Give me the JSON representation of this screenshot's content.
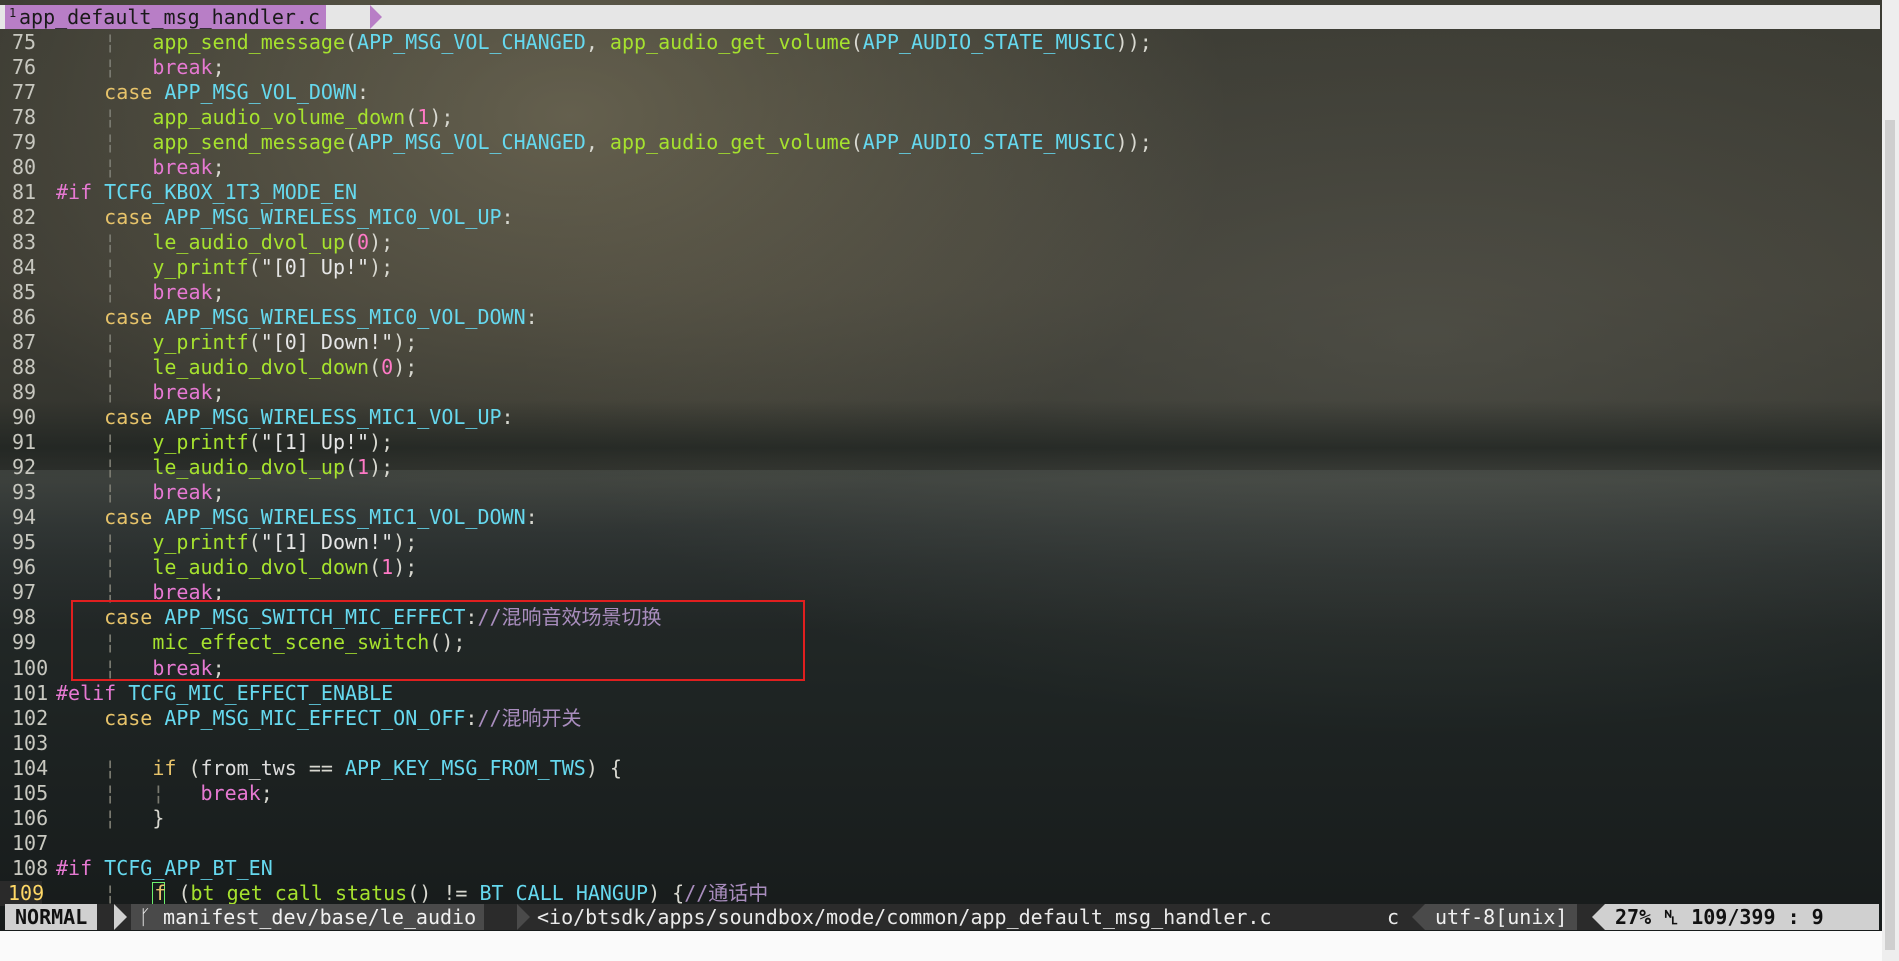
{
  "tab": {
    "number": "1",
    "filename": "app_default_msg_handler.c"
  },
  "lines": [
    {
      "n": "75",
      "guides": 1,
      "t": [
        [
          "fn",
          "app_send_message"
        ],
        [
          "punc",
          "("
        ],
        [
          "const",
          "APP_MSG_VOL_CHANGED"
        ],
        [
          "punc",
          ", "
        ],
        [
          "fn",
          "app_audio_get_volume"
        ],
        [
          "punc",
          "("
        ],
        [
          "const",
          "APP_AUDIO_STATE_MUSIC"
        ],
        [
          "punc",
          "));"
        ]
      ]
    },
    {
      "n": "76",
      "guides": 1,
      "t": [
        [
          "kw-break",
          "break"
        ],
        [
          "punc",
          ";"
        ]
      ]
    },
    {
      "n": "77",
      "guides": 0,
      "indent": 4,
      "t": [
        [
          "kw",
          "case "
        ],
        [
          "const",
          "APP_MSG_VOL_DOWN"
        ],
        [
          "punc",
          ":"
        ]
      ]
    },
    {
      "n": "78",
      "guides": 1,
      "t": [
        [
          "fn",
          "app_audio_volume_down"
        ],
        [
          "punc",
          "("
        ],
        [
          "num",
          "1"
        ],
        [
          "punc",
          ");"
        ]
      ]
    },
    {
      "n": "79",
      "guides": 1,
      "t": [
        [
          "fn",
          "app_send_message"
        ],
        [
          "punc",
          "("
        ],
        [
          "const",
          "APP_MSG_VOL_CHANGED"
        ],
        [
          "punc",
          ", "
        ],
        [
          "fn",
          "app_audio_get_volume"
        ],
        [
          "punc",
          "("
        ],
        [
          "const",
          "APP_AUDIO_STATE_MUSIC"
        ],
        [
          "punc",
          "));"
        ]
      ]
    },
    {
      "n": "80",
      "guides": 1,
      "t": [
        [
          "kw-break",
          "break"
        ],
        [
          "punc",
          ";"
        ]
      ]
    },
    {
      "n": "81",
      "guides": 0,
      "indent": 0,
      "t": [
        [
          "pp",
          "#if "
        ],
        [
          "const",
          "TCFG_KBOX_1T3_MODE_EN"
        ]
      ]
    },
    {
      "n": "82",
      "guides": 0,
      "indent": 4,
      "t": [
        [
          "kw",
          "case "
        ],
        [
          "const",
          "APP_MSG_WIRELESS_MIC0_VOL_UP"
        ],
        [
          "punc",
          ":"
        ]
      ]
    },
    {
      "n": "83",
      "guides": 1,
      "t": [
        [
          "fn",
          "le_audio_dvol_up"
        ],
        [
          "punc",
          "("
        ],
        [
          "num",
          "0"
        ],
        [
          "punc",
          ");"
        ]
      ]
    },
    {
      "n": "84",
      "guides": 1,
      "t": [
        [
          "fn",
          "y_printf"
        ],
        [
          "punc",
          "("
        ],
        [
          "str",
          "\"[0] Up!\""
        ],
        [
          "punc",
          ");"
        ]
      ]
    },
    {
      "n": "85",
      "guides": 1,
      "t": [
        [
          "kw-break",
          "break"
        ],
        [
          "punc",
          ";"
        ]
      ]
    },
    {
      "n": "86",
      "guides": 0,
      "indent": 4,
      "t": [
        [
          "kw",
          "case "
        ],
        [
          "const",
          "APP_MSG_WIRELESS_MIC0_VOL_DOWN"
        ],
        [
          "punc",
          ":"
        ]
      ]
    },
    {
      "n": "87",
      "guides": 1,
      "t": [
        [
          "fn",
          "y_printf"
        ],
        [
          "punc",
          "("
        ],
        [
          "str",
          "\"[0] Down!\""
        ],
        [
          "punc",
          ");"
        ]
      ]
    },
    {
      "n": "88",
      "guides": 1,
      "t": [
        [
          "fn",
          "le_audio_dvol_down"
        ],
        [
          "punc",
          "("
        ],
        [
          "num",
          "0"
        ],
        [
          "punc",
          ");"
        ]
      ]
    },
    {
      "n": "89",
      "guides": 1,
      "t": [
        [
          "kw-break",
          "break"
        ],
        [
          "punc",
          ";"
        ]
      ]
    },
    {
      "n": "90",
      "guides": 0,
      "indent": 4,
      "t": [
        [
          "kw",
          "case "
        ],
        [
          "const",
          "APP_MSG_WIRELESS_MIC1_VOL_UP"
        ],
        [
          "punc",
          ":"
        ]
      ]
    },
    {
      "n": "91",
      "guides": 1,
      "t": [
        [
          "fn",
          "y_printf"
        ],
        [
          "punc",
          "("
        ],
        [
          "str",
          "\"[1] Up!\""
        ],
        [
          "punc",
          ");"
        ]
      ]
    },
    {
      "n": "92",
      "guides": 1,
      "t": [
        [
          "fn",
          "le_audio_dvol_up"
        ],
        [
          "punc",
          "("
        ],
        [
          "num",
          "1"
        ],
        [
          "punc",
          ");"
        ]
      ]
    },
    {
      "n": "93",
      "guides": 1,
      "t": [
        [
          "kw-break",
          "break"
        ],
        [
          "punc",
          ";"
        ]
      ]
    },
    {
      "n": "94",
      "guides": 0,
      "indent": 4,
      "t": [
        [
          "kw",
          "case "
        ],
        [
          "const",
          "APP_MSG_WIRELESS_MIC1_VOL_DOWN"
        ],
        [
          "punc",
          ":"
        ]
      ]
    },
    {
      "n": "95",
      "guides": 1,
      "t": [
        [
          "fn",
          "y_printf"
        ],
        [
          "punc",
          "("
        ],
        [
          "str",
          "\"[1] Down!\""
        ],
        [
          "punc",
          ");"
        ]
      ]
    },
    {
      "n": "96",
      "guides": 1,
      "t": [
        [
          "fn",
          "le_audio_dvol_down"
        ],
        [
          "punc",
          "("
        ],
        [
          "num",
          "1"
        ],
        [
          "punc",
          ");"
        ]
      ]
    },
    {
      "n": "97",
      "guides": 1,
      "t": [
        [
          "kw-break",
          "break"
        ],
        [
          "punc",
          ";"
        ]
      ]
    },
    {
      "n": "98",
      "guides": 0,
      "indent": 4,
      "t": [
        [
          "kw",
          "case "
        ],
        [
          "const",
          "APP_MSG_SWITCH_MIC_EFFECT"
        ],
        [
          "punc",
          ":"
        ],
        [
          "cm",
          "//混响音效场景切换"
        ]
      ]
    },
    {
      "n": "99",
      "guides": 1,
      "t": [
        [
          "fn",
          "mic_effect_scene_switch"
        ],
        [
          "punc",
          "();"
        ]
      ]
    },
    {
      "n": "100",
      "guides": 1,
      "t": [
        [
          "kw-break",
          "break"
        ],
        [
          "punc",
          ";"
        ]
      ]
    },
    {
      "n": "101",
      "guides": 0,
      "indent": 0,
      "t": [
        [
          "pp",
          "#elif "
        ],
        [
          "const",
          "TCFG_MIC_EFFECT_ENABLE"
        ]
      ]
    },
    {
      "n": "102",
      "guides": 0,
      "indent": 4,
      "t": [
        [
          "kw",
          "case "
        ],
        [
          "const",
          "APP_MSG_MIC_EFFECT_ON_OFF"
        ],
        [
          "punc",
          ":"
        ],
        [
          "cm",
          "//混响开关"
        ]
      ]
    },
    {
      "n": "103",
      "guides": -1,
      "t": []
    },
    {
      "n": "104",
      "guides": 1,
      "t": [
        [
          "kw",
          "if "
        ],
        [
          "punc",
          "("
        ],
        [
          "macro",
          "from_tws"
        ],
        [
          "punc",
          " == "
        ],
        [
          "const",
          "APP_KEY_MSG_FROM_TWS"
        ],
        [
          "punc",
          ") {"
        ]
      ]
    },
    {
      "n": "105",
      "guides": 2,
      "t": [
        [
          "kw-break",
          "break"
        ],
        [
          "punc",
          ";"
        ]
      ]
    },
    {
      "n": "106",
      "guides": 1,
      "t": [
        [
          "punc",
          "}"
        ]
      ]
    },
    {
      "n": "107",
      "guides": -1,
      "t": []
    },
    {
      "n": "108",
      "guides": 0,
      "indent": 0,
      "t": [
        [
          "pp",
          "#if "
        ],
        [
          "const",
          "TCFG_APP_BT_EN"
        ]
      ]
    },
    {
      "n": "109",
      "guides": 1,
      "current": true,
      "t": [
        [
          "kw",
          "f "
        ],
        [
          "punc",
          "("
        ],
        [
          "fn",
          "bt_get_call_status"
        ],
        [
          "punc",
          "() != "
        ],
        [
          "const",
          "BT_CALL_HANGUP"
        ],
        [
          "punc",
          ") {"
        ],
        [
          "cm",
          "//通话中"
        ]
      ]
    }
  ],
  "status": {
    "mode": "NORMAL",
    "branch_icon": "ᚴ",
    "branch": "manifest_dev/base/le_audio",
    "filepath": "<io/btsdk/apps/soundbox/mode/common/app_default_msg_handler.c",
    "filetype": "c",
    "encoding": "utf-8[unix]",
    "percent": "27%",
    "line_icon": "␤",
    "position": "109/399",
    "sep": ":",
    "column": "9"
  },
  "colors": {
    "highlight_box": "#e01f1f",
    "tab_bg": "#b87ec6",
    "keyword": "#e7c36a",
    "function": "#a6e22e",
    "constant": "#66d9ef",
    "comment": "#a98dbe"
  }
}
